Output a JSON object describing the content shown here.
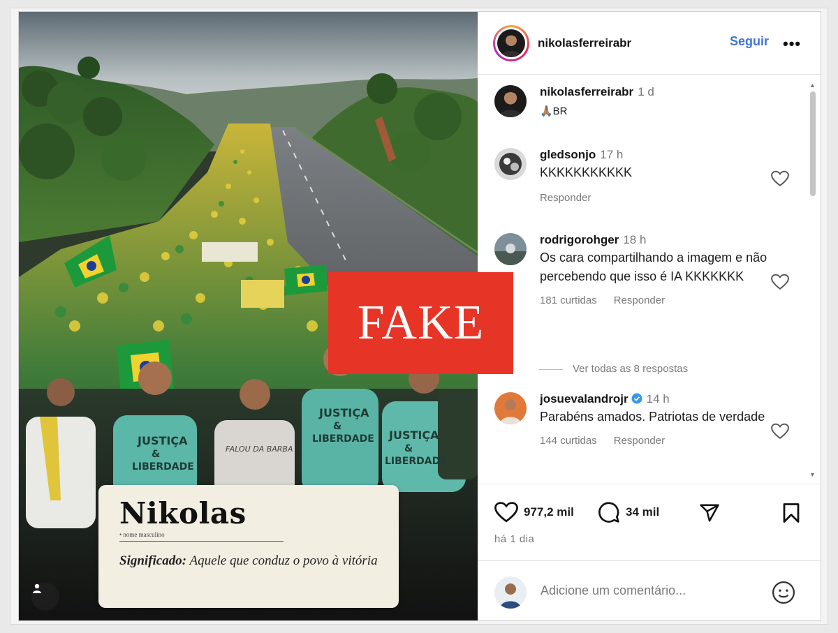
{
  "post": {
    "username": "nikolasferreirabr",
    "follow_label": "Seguir",
    "more_label": "•••",
    "caption_text": "🙏🏽BR",
    "caption_time": "1 d",
    "likes": "977,2 mil",
    "comments_count": "34 mil",
    "date": "há 1 dia"
  },
  "image": {
    "card_title": "Nikolas",
    "card_pos": "• nome masculino",
    "card_def_label": "Significado:",
    "card_def_text": " Aquele que conduz o povo à vitória",
    "overlay_stamp": "FAKE",
    "shirt_text_1": "JUSTIÇA",
    "shirt_text_2": "&",
    "shirt_text_3": "LIBERDADE",
    "shirt_text_4": "FALOU DA BARBA"
  },
  "comments": [
    {
      "user": "gledsonjo",
      "time": "17 h",
      "text": "KKKKKKKKKKK",
      "likes": "",
      "reply": "Responder"
    },
    {
      "user": "rodrigorohger",
      "time": "18 h",
      "text": "Os cara compartilhando a imagem e não percebendo que isso é IA KKKKKKK",
      "likes": "181 curtidas",
      "reply": "Responder"
    },
    {
      "user": "josuevalandrojr",
      "time": "14 h",
      "text": "Parabéns amados. Patriotas de verdade",
      "likes": "144 curtidas",
      "reply": "Responder"
    }
  ],
  "view_replies": "Ver todas as 8 respostas",
  "add_comment": {
    "placeholder": "Adicione um comentário..."
  },
  "colors": {
    "fake_red": "#e63427",
    "link_blue": "#3f74d8",
    "verified_blue": "#3897f0"
  },
  "icons": [
    "heart-icon",
    "comment-icon",
    "share-icon",
    "bookmark-icon",
    "emoji-icon",
    "more-icon",
    "verified-icon",
    "user-tag-icon"
  ]
}
